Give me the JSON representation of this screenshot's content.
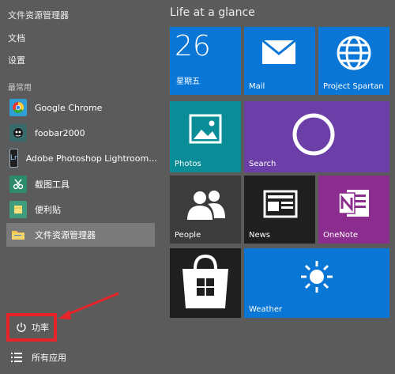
{
  "left": {
    "links": [
      "文件资源管理器",
      "文档",
      "设置"
    ],
    "section_title": "最常用",
    "apps": [
      {
        "name": "Google Chrome",
        "icon": "chrome-icon",
        "color": "#2f9fd8"
      },
      {
        "name": "foobar2000",
        "icon": "foobar2000-icon",
        "color": "#3a6b6b"
      },
      {
        "name": "Adobe Photoshop Lightroom...",
        "icon": "lightroom-icon",
        "color": "#1f1f1f"
      },
      {
        "name": "截图工具",
        "icon": "snipping-tool-icon",
        "color": "#2e8a6d"
      },
      {
        "name": "便利贴",
        "icon": "sticky-notes-icon",
        "color": "#3f9d7d"
      },
      {
        "name": "文件资源管理器",
        "icon": "folder-icon",
        "color": "#f2c44a"
      }
    ],
    "power_label": "功率",
    "all_apps_label": "所有应用"
  },
  "right": {
    "group_title": "Life at a glance",
    "tiles": {
      "calendar": {
        "day": "26",
        "weekday": "星期五"
      },
      "mail": "Mail",
      "spartan": "Project Spartan",
      "photos": "Photos",
      "search": "Search",
      "people": "People",
      "news": "News",
      "onenote": "OneNote",
      "store": "",
      "weather": "Weather"
    }
  },
  "colors": {
    "tile_blue": "#0a76d6",
    "tile_teal": "#0b8d97",
    "tile_purple": "#6b3ea8",
    "tile_dark": "#3c3c3c",
    "tile_onenote": "#8b2d8f",
    "highlight_red": "#e8242b"
  }
}
